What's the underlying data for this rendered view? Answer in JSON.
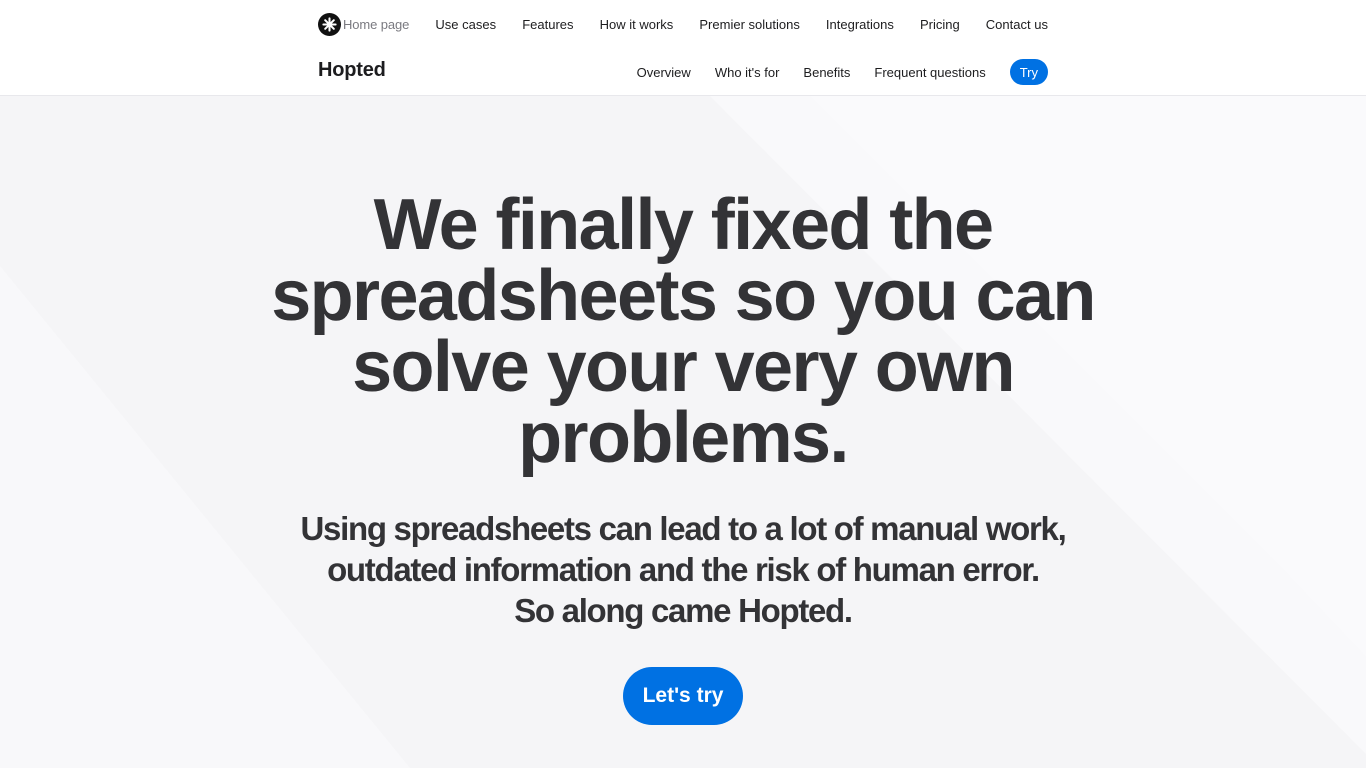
{
  "global_nav": {
    "logo_icon": "asterisk-logo-icon",
    "home_label": "Home page",
    "items": [
      {
        "label": "Use cases"
      },
      {
        "label": "Features"
      },
      {
        "label": "How it works"
      },
      {
        "label": "Premier solutions"
      },
      {
        "label": "Integrations"
      },
      {
        "label": "Pricing"
      },
      {
        "label": "Contact us"
      }
    ]
  },
  "sub_nav": {
    "product_name": "Hopted",
    "items": [
      {
        "label": "Overview"
      },
      {
        "label": "Who it's for"
      },
      {
        "label": "Benefits"
      },
      {
        "label": "Frequent questions"
      }
    ],
    "try_label": "Try"
  },
  "hero": {
    "headline_lines": [
      "We finally fixed the",
      "spreadsheets so you can",
      "solve your very own",
      "problems."
    ],
    "subhead_lines": [
      "Using spreadsheets can lead to a lot of manual work,",
      "outdated information and the risk of human error.",
      "So along came Hopted."
    ],
    "cta_label": "Let's try"
  },
  "colors": {
    "accent": "#0071e3",
    "text": "#333336",
    "hero_bg": "#f5f5f7"
  }
}
